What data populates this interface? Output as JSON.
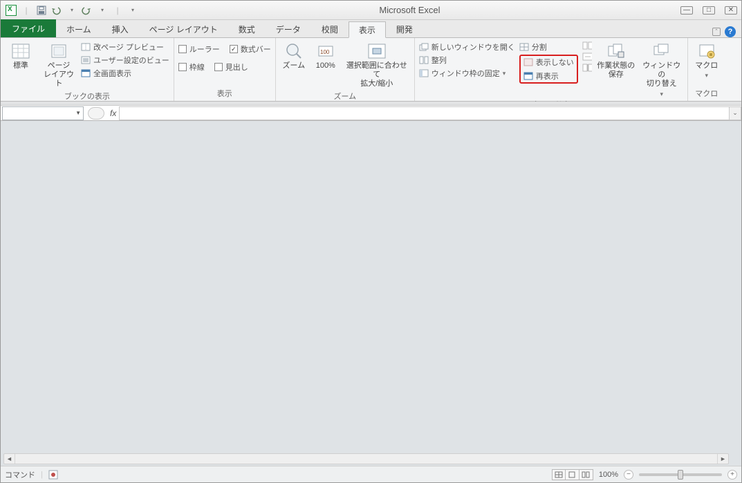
{
  "titlebar": {
    "app_title": "Microsoft Excel"
  },
  "tabs": {
    "file": "ファイル",
    "home": "ホーム",
    "insert": "挿入",
    "page_layout": "ページ レイアウト",
    "formulas": "数式",
    "data": "データ",
    "review": "校閲",
    "view": "表示",
    "developer": "開発"
  },
  "ribbon": {
    "group_book_views": "ブックの表示",
    "group_show": "表示",
    "group_zoom": "ズーム",
    "group_window": "ウィンドウ",
    "group_macro": "マクロ",
    "normal": "標準",
    "page_layout": "ページ\nレイアウト",
    "page_break_preview": "改ページ プレビュー",
    "custom_views": "ユーザー設定のビュー",
    "full_screen": "全画面表示",
    "ruler": "ルーラー",
    "formula_bar": "数式バー",
    "gridlines": "枠線",
    "headings": "見出し",
    "zoom": "ズーム",
    "zoom_100": "100%",
    "zoom_selection": "選択範囲に合わせて\n拡大/縮小",
    "new_window": "新しいウィンドウを開く",
    "arrange": "整列",
    "freeze_panes": "ウィンドウ枠の固定",
    "split": "分割",
    "hide": "表示しない",
    "unhide": "再表示",
    "save_workspace": "作業状態の\n保存",
    "switch_windows": "ウィンドウの\n切り替え",
    "macros": "マクロ"
  },
  "formula_bar": {
    "fx": "fx"
  },
  "status_bar": {
    "mode": "コマンド",
    "zoom": "100%"
  }
}
